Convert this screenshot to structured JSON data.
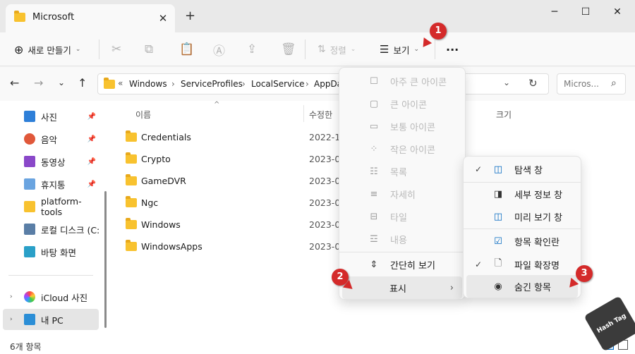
{
  "window": {
    "tab_title": "Microsoft",
    "new_tab": "+",
    "minimize": "─",
    "maximize": "☐",
    "close": "✕"
  },
  "toolbar": {
    "new_label": "새로 만들기",
    "sort_label": "정렬",
    "view_label": "보기",
    "more": "···"
  },
  "address": {
    "path": [
      "Windows",
      "ServiceProfiles",
      "LocalService",
      "AppDa"
    ],
    "prefix": "«",
    "search_placeholder": "Micros..."
  },
  "nav": {
    "items": [
      {
        "label": "사진",
        "color": "#2e7fd8",
        "pinned": true
      },
      {
        "label": "음악",
        "color": "#e0583a",
        "pinned": true
      },
      {
        "label": "동영상",
        "color": "#8a48c9",
        "pinned": true
      },
      {
        "label": "휴지통",
        "color": "#6aa4e0",
        "pinned": true
      },
      {
        "label": "platform-tools",
        "color": "#f8c22f",
        "pinned": false
      },
      {
        "label": "로컬 디스크 (C:)",
        "color": "#5a7ea6",
        "pinned": false
      },
      {
        "label": "바탕 화면",
        "color": "#2aa0c8",
        "pinned": false
      }
    ],
    "icloud": "iCloud 사진",
    "this_pc": "내 PC"
  },
  "columns": {
    "name": "이름",
    "modified": "수정한",
    "size": "크기"
  },
  "files": [
    {
      "name": "Credentials",
      "date": "2022-1"
    },
    {
      "name": "Crypto",
      "date": "2023-0"
    },
    {
      "name": "GameDVR",
      "date": "2023-0"
    },
    {
      "name": "Ngc",
      "date": "2023-0"
    },
    {
      "name": "Windows",
      "date": "2023-0"
    },
    {
      "name": "WindowsApps",
      "date": "2023-0"
    }
  ],
  "status": {
    "count": "6개 항목"
  },
  "view_menu": {
    "items": [
      "아주 큰 아이콘",
      "큰 아이콘",
      "보통 아이콘",
      "작은 아이콘",
      "목록",
      "자세히",
      "타일",
      "내용"
    ],
    "compact": "간단히 보기",
    "show": "표시"
  },
  "show_menu": {
    "items": [
      "탐색 창",
      "세부 정보 창",
      "미리 보기 창",
      "항목 확인란",
      "파일 확장명",
      "숨긴 항목"
    ],
    "checked": [
      "탐색 창",
      "파일 확장명"
    ]
  },
  "badges": [
    "1",
    "2",
    "3"
  ],
  "watermark": "Hash Tag",
  "colors": {
    "accent": "#0067c0",
    "badge": "#d42a2a"
  }
}
